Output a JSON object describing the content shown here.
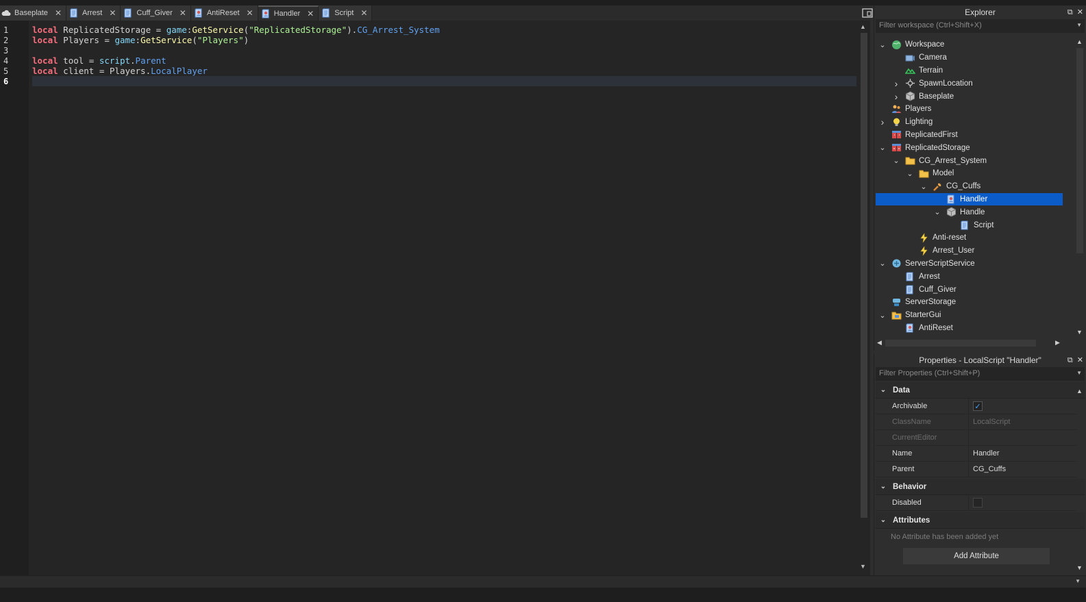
{
  "tabs": [
    {
      "label": "Baseplate",
      "icon": "cloud-icon",
      "active": false
    },
    {
      "label": "Arrest",
      "icon": "script-icon",
      "active": false
    },
    {
      "label": "Cuff_Giver",
      "icon": "script-icon",
      "active": false
    },
    {
      "label": "AntiReset",
      "icon": "localscript-icon",
      "active": false
    },
    {
      "label": "Handler",
      "icon": "localscript-icon",
      "active": true
    },
    {
      "label": "Script",
      "icon": "script-icon",
      "active": false
    }
  ],
  "editor": {
    "line_numbers": [
      "1",
      "2",
      "3",
      "4",
      "5",
      "6"
    ],
    "current_line": "6",
    "lines": [
      [
        {
          "t": "local",
          "c": "kw"
        },
        {
          "t": " ReplicatedStorage = ",
          "c": ""
        },
        {
          "t": "game",
          "c": "bi"
        },
        {
          "t": ":",
          "c": ""
        },
        {
          "t": "GetService",
          "c": "fn"
        },
        {
          "t": "(",
          "c": ""
        },
        {
          "t": "\"ReplicatedStorage\"",
          "c": "str"
        },
        {
          "t": ").",
          "c": ""
        },
        {
          "t": "CG_Arrest_System",
          "c": "prop"
        }
      ],
      [
        {
          "t": "local",
          "c": "kw"
        },
        {
          "t": " Players = ",
          "c": ""
        },
        {
          "t": "game",
          "c": "bi"
        },
        {
          "t": ":",
          "c": ""
        },
        {
          "t": "GetService",
          "c": "fn"
        },
        {
          "t": "(",
          "c": ""
        },
        {
          "t": "\"Players\"",
          "c": "str"
        },
        {
          "t": ")",
          "c": ""
        }
      ],
      [],
      [
        {
          "t": "local",
          "c": "kw"
        },
        {
          "t": " tool = ",
          "c": ""
        },
        {
          "t": "script",
          "c": "bi"
        },
        {
          "t": ".",
          "c": ""
        },
        {
          "t": "Parent",
          "c": "prop"
        }
      ],
      [
        {
          "t": "local",
          "c": "kw"
        },
        {
          "t": " client = Players.",
          "c": ""
        },
        {
          "t": "LocalPlayer",
          "c": "prop"
        }
      ],
      []
    ]
  },
  "explorer": {
    "title": "Explorer",
    "filter_placeholder": "Filter workspace (Ctrl+Shift+X)",
    "items": [
      {
        "label": "Workspace",
        "depth": 0,
        "chevron": "down",
        "icon": "workspace-icon"
      },
      {
        "label": "Camera",
        "depth": 1,
        "chevron": "",
        "icon": "camera-icon"
      },
      {
        "label": "Terrain",
        "depth": 1,
        "chevron": "",
        "icon": "terrain-icon"
      },
      {
        "label": "SpawnLocation",
        "depth": 1,
        "chevron": "right",
        "icon": "spawn-icon"
      },
      {
        "label": "Baseplate",
        "depth": 1,
        "chevron": "right",
        "icon": "part-icon"
      },
      {
        "label": "Players",
        "depth": 0,
        "chevron": "",
        "icon": "players-icon"
      },
      {
        "label": "Lighting",
        "depth": 0,
        "chevron": "right",
        "icon": "lighting-icon"
      },
      {
        "label": "ReplicatedFirst",
        "depth": 0,
        "chevron": "",
        "icon": "replicated-first-icon"
      },
      {
        "label": "ReplicatedStorage",
        "depth": 0,
        "chevron": "down",
        "icon": "replicated-storage-icon"
      },
      {
        "label": "CG_Arrest_System",
        "depth": 1,
        "chevron": "down",
        "icon": "folder-icon"
      },
      {
        "label": "Model",
        "depth": 2,
        "chevron": "down",
        "icon": "folder-icon"
      },
      {
        "label": "CG_Cuffs",
        "depth": 3,
        "chevron": "down",
        "icon": "tool-icon"
      },
      {
        "label": "Handler",
        "depth": 4,
        "chevron": "",
        "icon": "localscript-icon",
        "selected": true
      },
      {
        "label": "Handle",
        "depth": 4,
        "chevron": "down",
        "icon": "part-icon"
      },
      {
        "label": "Script",
        "depth": 5,
        "chevron": "",
        "icon": "script-icon"
      },
      {
        "label": "Anti-reset",
        "depth": 2,
        "chevron": "",
        "icon": "remote-event-icon"
      },
      {
        "label": "Arrest_User",
        "depth": 2,
        "chevron": "",
        "icon": "remote-event-icon"
      },
      {
        "label": "ServerScriptService",
        "depth": 0,
        "chevron": "down",
        "icon": "server-script-service-icon"
      },
      {
        "label": "Arrest",
        "depth": 1,
        "chevron": "",
        "icon": "script-icon"
      },
      {
        "label": "Cuff_Giver",
        "depth": 1,
        "chevron": "",
        "icon": "script-icon"
      },
      {
        "label": "ServerStorage",
        "depth": 0,
        "chevron": "",
        "icon": "server-storage-icon"
      },
      {
        "label": "StarterGui",
        "depth": 0,
        "chevron": "down",
        "icon": "starter-gui-icon"
      },
      {
        "label": "AntiReset",
        "depth": 1,
        "chevron": "",
        "icon": "localscript-icon"
      }
    ]
  },
  "properties": {
    "title": "Properties - LocalScript \"Handler\"",
    "filter_placeholder": "Filter Properties (Ctrl+Shift+P)",
    "sections": {
      "data": "Data",
      "behavior": "Behavior",
      "attributes": "Attributes"
    },
    "rows": {
      "archivable": {
        "name": "Archivable",
        "checked": true
      },
      "classname": {
        "name": "ClassName",
        "value": "LocalScript"
      },
      "currenteditor": {
        "name": "CurrentEditor",
        "value": ""
      },
      "name": {
        "name": "Name",
        "value": "Handler"
      },
      "parent": {
        "name": "Parent",
        "value": "CG_Cuffs"
      },
      "disabled": {
        "name": "Disabled",
        "checked": false
      }
    },
    "no_attribute_text": "No Attribute has been added yet",
    "add_attribute_label": "Add Attribute"
  },
  "colors": {
    "keyword": "#f86d7c",
    "string": "#adf195",
    "function": "#fdfbac",
    "property": "#61a1f1",
    "selection": "#0b5bc9"
  }
}
